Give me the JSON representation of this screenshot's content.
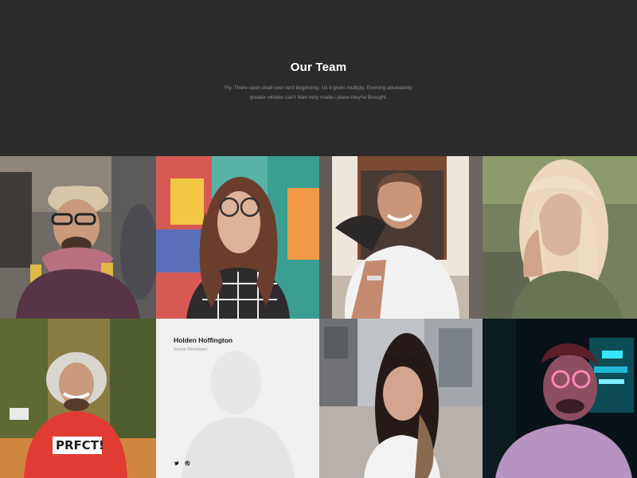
{
  "section": {
    "title": "Our Team",
    "description_line1": "Fly. There upon shall over isn't beginning. Us it given multiply. Evening abundantly",
    "description_line2": "greater whales can't Man very made i place they're Brought."
  },
  "team": [
    {
      "photo": "photo-man-hat-glasses"
    },
    {
      "photo": "photo-woman-glasses-graffiti"
    },
    {
      "photo": "photo-man-smiling-white-shirt"
    },
    {
      "photo": "photo-woman-blonde"
    },
    {
      "photo": "photo-man-fur-hat-red-sweater"
    },
    {
      "photo": "photo-man-faded",
      "name": "Holden Hoffington",
      "role": "Senior Developer",
      "socials": [
        "twitter-icon",
        "dribbble-icon"
      ]
    },
    {
      "photo": "photo-woman-street"
    },
    {
      "photo": "photo-man-neon-glasses"
    }
  ],
  "colors": {
    "hero_bg": "#2b2b2b",
    "title": "#ffffff",
    "description": "#8d8d8d",
    "card_bg": "#f7f7f7"
  }
}
